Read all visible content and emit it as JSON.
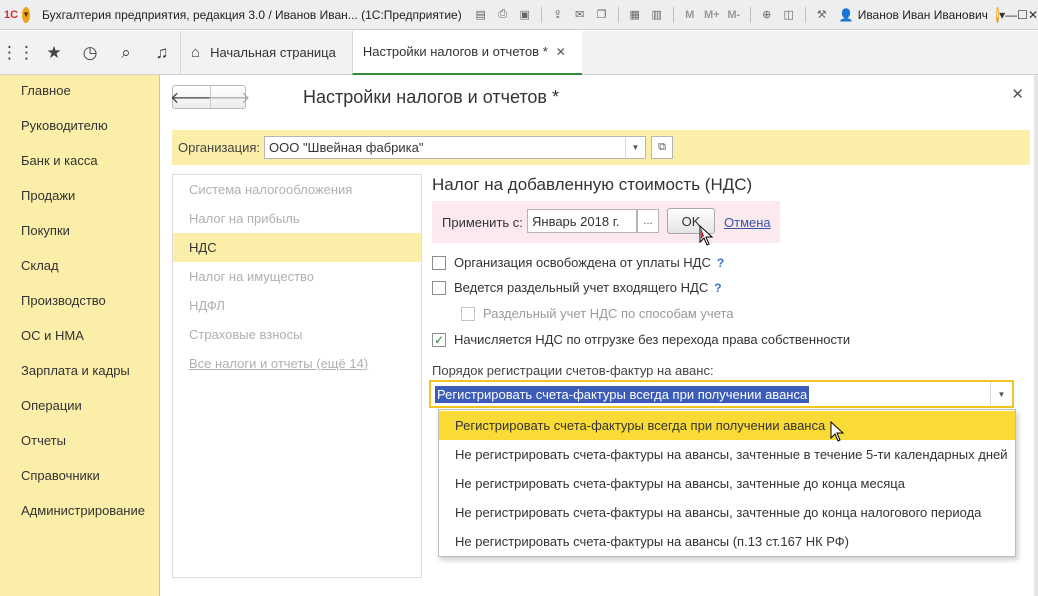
{
  "titlebar": {
    "app_title": "Бухгалтерия предприятия, редакция 3.0 / Иванов Иван...  (1С:Предприятие)",
    "user": "Иванов Иван Иванович",
    "m_buttons": [
      "M",
      "M+",
      "M-"
    ]
  },
  "navbar": {
    "tabs": [
      {
        "label": "Начальная страница"
      },
      {
        "label": "Настройки налогов и отчетов *"
      }
    ]
  },
  "sidebar": {
    "items": [
      {
        "label": "Главное"
      },
      {
        "label": "Руководителю"
      },
      {
        "label": "Банк и касса"
      },
      {
        "label": "Продажи"
      },
      {
        "label": "Покупки"
      },
      {
        "label": "Склад"
      },
      {
        "label": "Производство"
      },
      {
        "label": "ОС и НМА"
      },
      {
        "label": "Зарплата и кадры"
      },
      {
        "label": "Операции"
      },
      {
        "label": "Отчеты"
      },
      {
        "label": "Справочники"
      },
      {
        "label": "Администрирование"
      }
    ]
  },
  "page": {
    "title": "Настройки налогов и отчетов *",
    "org_label": "Организация:",
    "org_value": "ООО \"Швейная фабрика\""
  },
  "leftnav": {
    "items": [
      {
        "label": "Система налогообложения"
      },
      {
        "label": "Налог на прибыль"
      },
      {
        "label": "НДС"
      },
      {
        "label": "Налог на имущество"
      },
      {
        "label": "НДФЛ"
      },
      {
        "label": "Страховые взносы"
      },
      {
        "label": "Все налоги и отчеты (ещё 14)"
      }
    ],
    "active_index": 2
  },
  "vat": {
    "section_title": "Налог на добавленную стоимость (НДС)",
    "apply_label": "Применить с:",
    "apply_value": "Январь 2018 г.",
    "dots_label": "...",
    "ok_label": "OK",
    "cancel_label": "Отмена",
    "checkboxes": [
      {
        "label": "Организация освобождена от уплаты НДС",
        "checked": false,
        "help": "?"
      },
      {
        "label": "Ведется раздельный учет входящего НДС",
        "checked": false,
        "help": "?"
      },
      {
        "label": "Раздельный учет НДС по способам учета",
        "checked": false,
        "disabled": true
      },
      {
        "label": "Начисляется НДС по отгрузке без перехода права собственности",
        "checked": true
      }
    ],
    "order_label": "Порядок регистрации счетов-фактур на аванс:",
    "order_value": "Регистрировать счета-фактуры всегда при получении аванса",
    "options": [
      {
        "label": "Регистрировать счета-фактуры всегда при получении аванса"
      },
      {
        "label": "Не регистрировать счета-фактуры на авансы, зачтенные в течение 5-ти календарных дней"
      },
      {
        "label": "Не регистрировать счета-фактуры на авансы, зачтенные до конца месяца"
      },
      {
        "label": "Не регистрировать счета-фактуры на авансы, зачтенные до конца налогового периода"
      },
      {
        "label": "Не регистрировать счета-фактуры на авансы (п.13 ст.167 НК РФ)"
      }
    ],
    "selected_option": 0
  },
  "colors": {
    "sidebar_bg": "#fbeea9",
    "accent_green": "#2e8c3a",
    "selection_blue": "#3b5cb8",
    "highlight_yellow": "#fadb36",
    "apply_bg": "#fbe9ee"
  }
}
